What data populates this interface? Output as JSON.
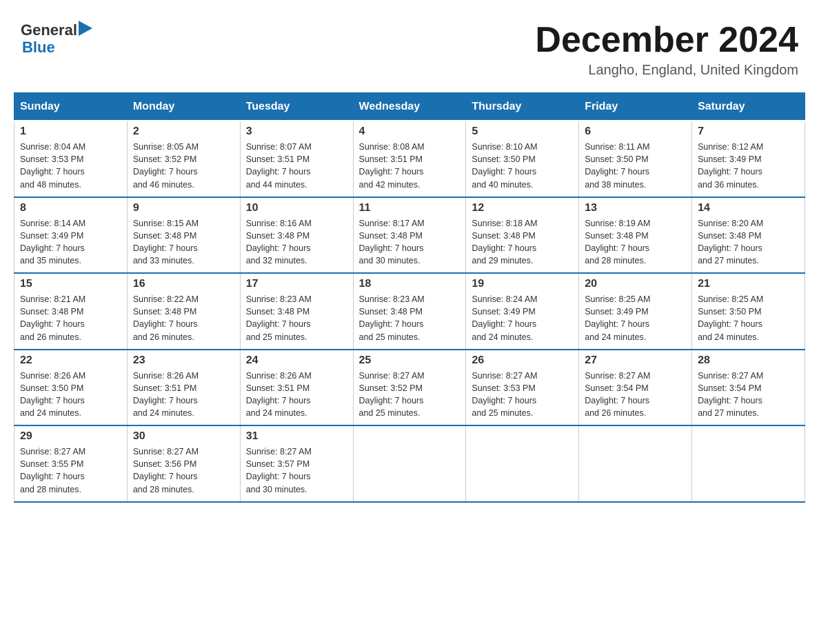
{
  "header": {
    "logo_general": "General",
    "logo_blue": "Blue",
    "month_title": "December 2024",
    "location": "Langho, England, United Kingdom"
  },
  "weekdays": [
    "Sunday",
    "Monday",
    "Tuesday",
    "Wednesday",
    "Thursday",
    "Friday",
    "Saturday"
  ],
  "weeks": [
    [
      {
        "day": "1",
        "sunrise": "8:04 AM",
        "sunset": "3:53 PM",
        "daylight": "7 hours and 48 minutes."
      },
      {
        "day": "2",
        "sunrise": "8:05 AM",
        "sunset": "3:52 PM",
        "daylight": "7 hours and 46 minutes."
      },
      {
        "day": "3",
        "sunrise": "8:07 AM",
        "sunset": "3:51 PM",
        "daylight": "7 hours and 44 minutes."
      },
      {
        "day": "4",
        "sunrise": "8:08 AM",
        "sunset": "3:51 PM",
        "daylight": "7 hours and 42 minutes."
      },
      {
        "day": "5",
        "sunrise": "8:10 AM",
        "sunset": "3:50 PM",
        "daylight": "7 hours and 40 minutes."
      },
      {
        "day": "6",
        "sunrise": "8:11 AM",
        "sunset": "3:50 PM",
        "daylight": "7 hours and 38 minutes."
      },
      {
        "day": "7",
        "sunrise": "8:12 AM",
        "sunset": "3:49 PM",
        "daylight": "7 hours and 36 minutes."
      }
    ],
    [
      {
        "day": "8",
        "sunrise": "8:14 AM",
        "sunset": "3:49 PM",
        "daylight": "7 hours and 35 minutes."
      },
      {
        "day": "9",
        "sunrise": "8:15 AM",
        "sunset": "3:48 PM",
        "daylight": "7 hours and 33 minutes."
      },
      {
        "day": "10",
        "sunrise": "8:16 AM",
        "sunset": "3:48 PM",
        "daylight": "7 hours and 32 minutes."
      },
      {
        "day": "11",
        "sunrise": "8:17 AM",
        "sunset": "3:48 PM",
        "daylight": "7 hours and 30 minutes."
      },
      {
        "day": "12",
        "sunrise": "8:18 AM",
        "sunset": "3:48 PM",
        "daylight": "7 hours and 29 minutes."
      },
      {
        "day": "13",
        "sunrise": "8:19 AM",
        "sunset": "3:48 PM",
        "daylight": "7 hours and 28 minutes."
      },
      {
        "day": "14",
        "sunrise": "8:20 AM",
        "sunset": "3:48 PM",
        "daylight": "7 hours and 27 minutes."
      }
    ],
    [
      {
        "day": "15",
        "sunrise": "8:21 AM",
        "sunset": "3:48 PM",
        "daylight": "7 hours and 26 minutes."
      },
      {
        "day": "16",
        "sunrise": "8:22 AM",
        "sunset": "3:48 PM",
        "daylight": "7 hours and 26 minutes."
      },
      {
        "day": "17",
        "sunrise": "8:23 AM",
        "sunset": "3:48 PM",
        "daylight": "7 hours and 25 minutes."
      },
      {
        "day": "18",
        "sunrise": "8:23 AM",
        "sunset": "3:48 PM",
        "daylight": "7 hours and 25 minutes."
      },
      {
        "day": "19",
        "sunrise": "8:24 AM",
        "sunset": "3:49 PM",
        "daylight": "7 hours and 24 minutes."
      },
      {
        "day": "20",
        "sunrise": "8:25 AM",
        "sunset": "3:49 PM",
        "daylight": "7 hours and 24 minutes."
      },
      {
        "day": "21",
        "sunrise": "8:25 AM",
        "sunset": "3:50 PM",
        "daylight": "7 hours and 24 minutes."
      }
    ],
    [
      {
        "day": "22",
        "sunrise": "8:26 AM",
        "sunset": "3:50 PM",
        "daylight": "7 hours and 24 minutes."
      },
      {
        "day": "23",
        "sunrise": "8:26 AM",
        "sunset": "3:51 PM",
        "daylight": "7 hours and 24 minutes."
      },
      {
        "day": "24",
        "sunrise": "8:26 AM",
        "sunset": "3:51 PM",
        "daylight": "7 hours and 24 minutes."
      },
      {
        "day": "25",
        "sunrise": "8:27 AM",
        "sunset": "3:52 PM",
        "daylight": "7 hours and 25 minutes."
      },
      {
        "day": "26",
        "sunrise": "8:27 AM",
        "sunset": "3:53 PM",
        "daylight": "7 hours and 25 minutes."
      },
      {
        "day": "27",
        "sunrise": "8:27 AM",
        "sunset": "3:54 PM",
        "daylight": "7 hours and 26 minutes."
      },
      {
        "day": "28",
        "sunrise": "8:27 AM",
        "sunset": "3:54 PM",
        "daylight": "7 hours and 27 minutes."
      }
    ],
    [
      {
        "day": "29",
        "sunrise": "8:27 AM",
        "sunset": "3:55 PM",
        "daylight": "7 hours and 28 minutes."
      },
      {
        "day": "30",
        "sunrise": "8:27 AM",
        "sunset": "3:56 PM",
        "daylight": "7 hours and 28 minutes."
      },
      {
        "day": "31",
        "sunrise": "8:27 AM",
        "sunset": "3:57 PM",
        "daylight": "7 hours and 30 minutes."
      },
      {
        "day": "",
        "sunrise": "",
        "sunset": "",
        "daylight": ""
      },
      {
        "day": "",
        "sunrise": "",
        "sunset": "",
        "daylight": ""
      },
      {
        "day": "",
        "sunrise": "",
        "sunset": "",
        "daylight": ""
      },
      {
        "day": "",
        "sunrise": "",
        "sunset": "",
        "daylight": ""
      }
    ]
  ]
}
